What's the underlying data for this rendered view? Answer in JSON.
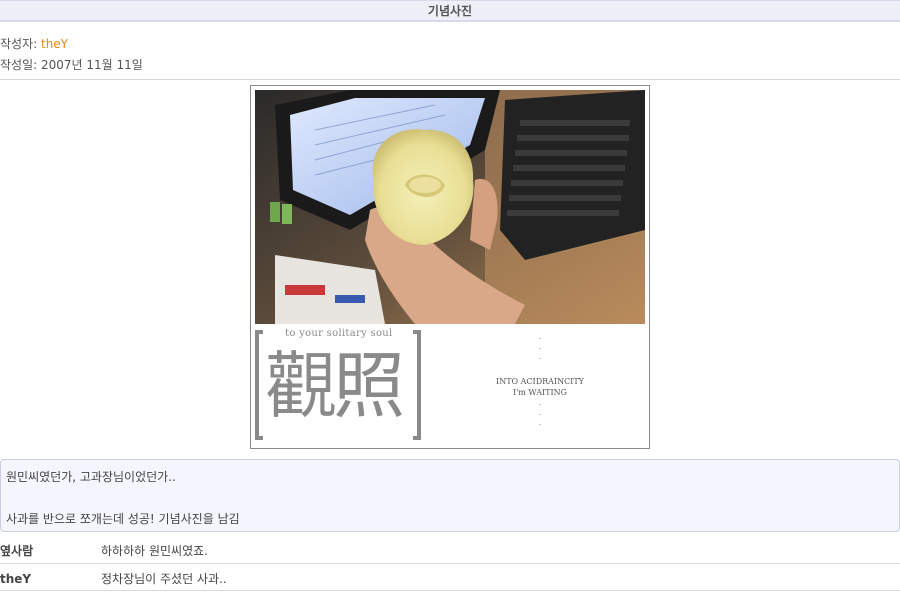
{
  "post": {
    "title": "기념사진",
    "author_label": "작성자: ",
    "author_name": "theY",
    "date_label": "작성일: ",
    "date_value": "2007년 11월 11일"
  },
  "photo": {
    "caption_top": "to your solitary soul",
    "hanja": "觀照",
    "side_dots_top": ".\n.\n.",
    "side_text_line1": "INTO ACIDRAINCITY",
    "side_text_line2": "I'm WAITING",
    "side_dots_bottom": ".\n.\n."
  },
  "memo": {
    "line1": "원민씨였던가, 고과장님이었던가..",
    "line2": "",
    "line3": "사과를 반으로 쪼개는데 성공! 기념사진을 남김"
  },
  "comments": [
    {
      "name": "옆사람",
      "text": "하하하하 원민씨였죠."
    },
    {
      "name": "theY",
      "text": "정차장님이 주셨던 사과.."
    }
  ]
}
